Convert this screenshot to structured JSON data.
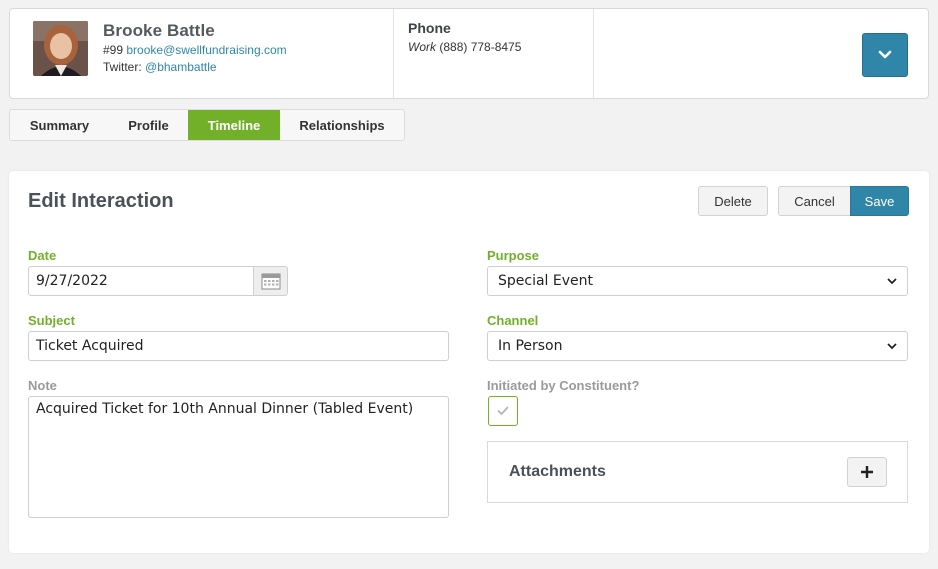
{
  "contact": {
    "name": "Brooke Battle",
    "id_number": "#99",
    "email": "brooke@swellfundraising.com",
    "twitter_label": "Twitter:",
    "twitter_handle": "@bhambattle"
  },
  "phone": {
    "label": "Phone",
    "type": "Work",
    "number": "(888) 778-8475"
  },
  "header": {
    "expand_icon": "chevron-down-icon"
  },
  "tabs": [
    {
      "label": "Summary",
      "active": false
    },
    {
      "label": "Profile",
      "active": false
    },
    {
      "label": "Timeline",
      "active": true
    },
    {
      "label": "Relationships",
      "active": false
    }
  ],
  "form": {
    "title": "Edit Interaction",
    "delete_label": "Delete",
    "cancel_label": "Cancel",
    "save_label": "Save",
    "date": {
      "label": "Date",
      "value": "9/27/2022"
    },
    "subject": {
      "label": "Subject",
      "value": "Ticket Acquired"
    },
    "note": {
      "label": "Note",
      "value": "Acquired Ticket for 10th Annual Dinner (Tabled Event)"
    },
    "purpose": {
      "label": "Purpose",
      "value": "Special Event"
    },
    "channel": {
      "label": "Channel",
      "value": "In Person"
    },
    "initiated": {
      "label": "Initiated by Constituent?",
      "checked": true
    },
    "attachments": {
      "title": "Attachments",
      "add_label": "+"
    }
  },
  "colors": {
    "accent_green": "#72b02a",
    "primary_blue": "#2f86a8",
    "link_blue": "#2e87a6"
  }
}
